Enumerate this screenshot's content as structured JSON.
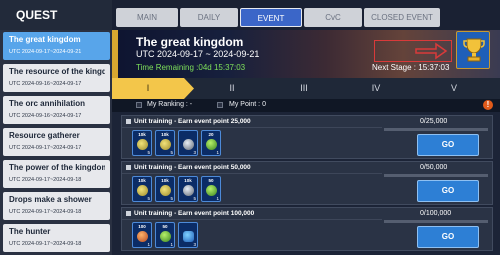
{
  "nav": {
    "quest_label": "QUEST"
  },
  "tabs": [
    "MAIN",
    "DAILY",
    "EVENT",
    "CvC",
    "CLOSED EVENT"
  ],
  "quests": [
    {
      "name": "The great kingdom",
      "date": "UTC 2024-09-17~2024-09-21"
    },
    {
      "name": "The resource of the kingdom",
      "date": "UTC 2024-09-16~2024-09-17"
    },
    {
      "name": "The orc annihilation",
      "date": "UTC 2024-09-16~2024-09-17"
    },
    {
      "name": "Resource gatherer",
      "date": "UTC 2024-09-17~2024-09-17"
    },
    {
      "name": "The power of the kingdom",
      "date": "UTC 2024-09-17~2024-09-18"
    },
    {
      "name": "Drops make a shower",
      "date": "UTC 2024-09-17~2024-09-18"
    },
    {
      "name": "The hunter",
      "date": "UTC 2024-09-17~2024-09-18"
    }
  ],
  "banner": {
    "title": "The great kingdom",
    "utc": "UTC 2024-09-17 ~ 2024-09-21",
    "time_remaining": "Time Remaining :04d 15:37:03",
    "next_stage": "Next Stage : 15:37:03",
    "icons": {
      "arrow": "arrow-icon",
      "trophy": "trophy-icon"
    }
  },
  "stages": [
    "I",
    "II",
    "III",
    "IV",
    "V"
  ],
  "ranking": {
    "my_ranking": "My Ranking : -",
    "my_point": "My Point : 0",
    "warning_icon": "!"
  },
  "accent_colors": {
    "active_tab": "#3b66c8",
    "active_quest": "#58a5ea",
    "active_stage": "#f3c64a",
    "go_button": "#2d7fd5",
    "time_text": "#7ee05a"
  },
  "cards": [
    {
      "title": "Unit training - Earn event point 25,000",
      "progress": "0/25,000",
      "progress_fraction": 0,
      "go_label": "GO",
      "rewards": [
        {
          "label": "10k",
          "count": "5",
          "icon": "wheat-icon"
        },
        {
          "label": "10k",
          "count": "5",
          "icon": "wood-icon"
        },
        {
          "label": "",
          "count": "3",
          "icon": "ore-icon"
        },
        {
          "label": "20",
          "count": "1",
          "icon": "gem-icon"
        }
      ]
    },
    {
      "title": "Unit training - Earn event point 50,000",
      "progress": "0/50,000",
      "progress_fraction": 0,
      "go_label": "GO",
      "rewards": [
        {
          "label": "10k",
          "count": "5",
          "icon": "wheat-icon"
        },
        {
          "label": "10k",
          "count": "5",
          "icon": "wood-icon"
        },
        {
          "label": "10k",
          "count": "5",
          "icon": "ore-icon"
        },
        {
          "label": "50",
          "count": "1",
          "icon": "gem-icon"
        }
      ]
    },
    {
      "title": "Unit training - Earn event point 100,000",
      "progress": "0/100,000",
      "progress_fraction": 0,
      "go_label": "GO",
      "rewards": [
        {
          "label": "100",
          "count": "1",
          "icon": "food-icon"
        },
        {
          "label": "50",
          "count": "1",
          "icon": "gem-icon"
        },
        {
          "label": "",
          "count": "3",
          "icon": "speedup-icon"
        }
      ]
    }
  ]
}
